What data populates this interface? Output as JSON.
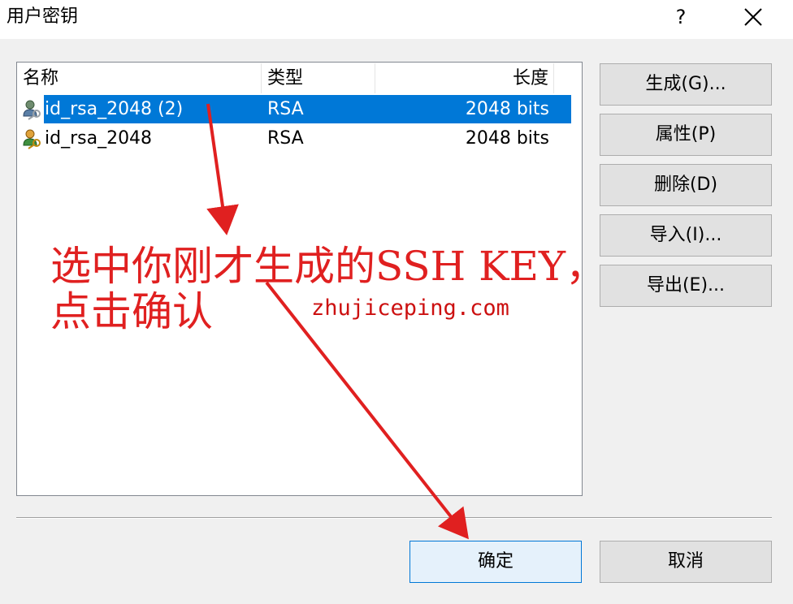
{
  "window": {
    "title": "用户密钥",
    "help_label": "?",
    "close_icon": "close-icon"
  },
  "key_list": {
    "columns": {
      "name": "名称",
      "type": "类型",
      "length": "长度"
    },
    "rows": [
      {
        "name": "id_rsa_2048 (2)",
        "type": "RSA",
        "length": "2048 bits",
        "selected": true,
        "icon": "user-key-icon"
      },
      {
        "name": "id_rsa_2048",
        "type": "RSA",
        "length": "2048 bits",
        "selected": false,
        "icon": "user-key-icon"
      }
    ]
  },
  "side_buttons": {
    "generate": "生成(G)...",
    "properties": "属性(P)",
    "delete": "删除(D)",
    "import": "导入(I)...",
    "export": "导出(E)..."
  },
  "footer": {
    "ok": "确定",
    "cancel": "取消"
  },
  "annotation": {
    "line1": "选中你刚才生成的SSH KEY，",
    "line2": "点击确认",
    "watermark": "zhujiceping.com",
    "color": "#e02020"
  },
  "colors": {
    "selection": "#0078d7",
    "default_button_border": "#0078d7",
    "default_button_bg": "#e5f1fb"
  }
}
